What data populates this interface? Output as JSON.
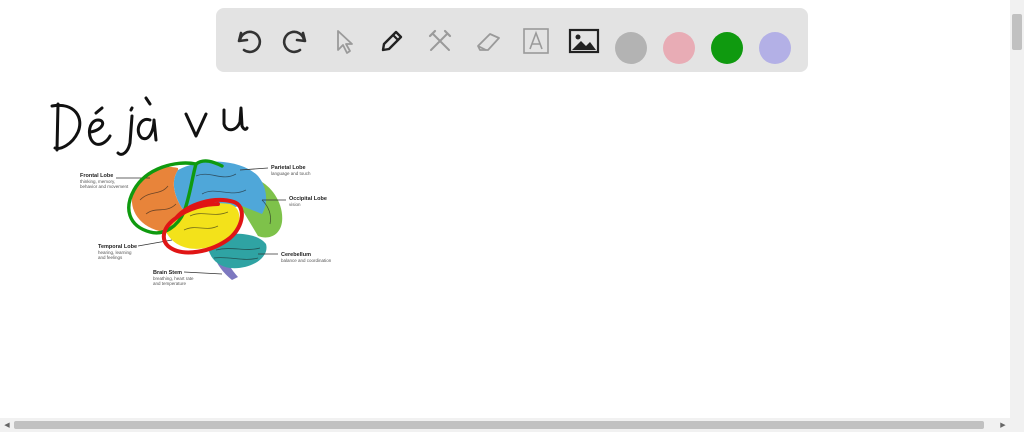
{
  "toolbar": {
    "tools": [
      {
        "name": "undo-icon"
      },
      {
        "name": "redo-icon"
      },
      {
        "name": "select-arrow-icon"
      },
      {
        "name": "pen-icon"
      },
      {
        "name": "tools-icon"
      },
      {
        "name": "eraser-icon"
      },
      {
        "name": "text-icon"
      },
      {
        "name": "image-icon"
      }
    ],
    "colors": [
      "#b3b3b3",
      "#e8acb5",
      "#0f9a0f",
      "#b3b0e6"
    ]
  },
  "canvas": {
    "handwriting": "Déjà vu",
    "diagram": {
      "labels": {
        "frontal": {
          "title": "Frontal Lobe",
          "lines": [
            "thinking, memory,",
            "behavior and movement"
          ]
        },
        "parietal": {
          "title": "Parietal Lobe",
          "lines": [
            "language and touch"
          ]
        },
        "occipital": {
          "title": "Occipital Lobe",
          "lines": [
            "vision"
          ]
        },
        "temporal": {
          "title": "Temporal Lobe",
          "lines": [
            "hearing, learning",
            "and feelings"
          ]
        },
        "cerebellum": {
          "title": "Cerebellum",
          "lines": [
            "balance and coordination"
          ]
        },
        "brainstem": {
          "title": "Brain Stem",
          "lines": [
            "breathing, heart rate",
            "and temperature"
          ]
        }
      }
    }
  }
}
